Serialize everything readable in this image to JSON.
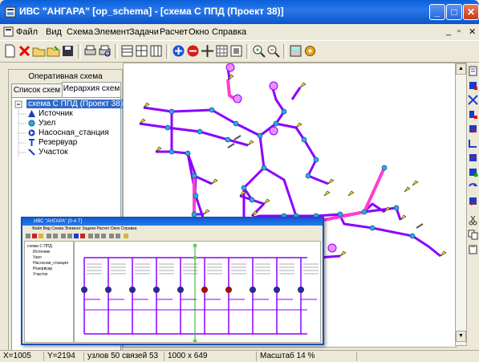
{
  "window": {
    "title": "ИВС \"АНГАРА\" [op_schema] - [схема  С ППД (Проект 38)]",
    "controls": [
      "_",
      "□",
      "✕"
    ]
  },
  "menu": {
    "items": [
      "Файл",
      "Вид",
      "Схема",
      "Элемент",
      "Задачи",
      "Расчет",
      "Окно",
      "Справка"
    ],
    "mdi_controls": [
      "_",
      "▫",
      "✕"
    ]
  },
  "left_panel": {
    "title": "Оперативная схема",
    "tabs": [
      "Список схем",
      "Иерархия схем"
    ],
    "tree": {
      "root": "схема  С ППД (Проект 38)",
      "children": [
        "Источник",
        "Узел",
        "Насосная_станция",
        "Резервуар",
        "Участок"
      ]
    }
  },
  "inset": {
    "title": "ИВС \"АНГАРА\" [0-4 Т]",
    "menu": "Файл Вид Схема Элемент Задачи Расчет Окно Справка",
    "tree_items": [
      "схема  С ППД",
      "Источник",
      "Узел",
      "Насосная_станция",
      "Резервуар",
      "Участок"
    ]
  },
  "status": {
    "x": "X=1005",
    "y": "Y=2194",
    "node": "узлов 50 связей 53",
    "size": "1000 x 649",
    "scale": "Масштаб 14 %"
  },
  "colors": {
    "pipe_main": "#8b00ff",
    "pipe_highlight": "#ff3ecf",
    "node": "#2fa8e0",
    "consumer": "#f5e700",
    "accent": "#0a5fd9"
  }
}
